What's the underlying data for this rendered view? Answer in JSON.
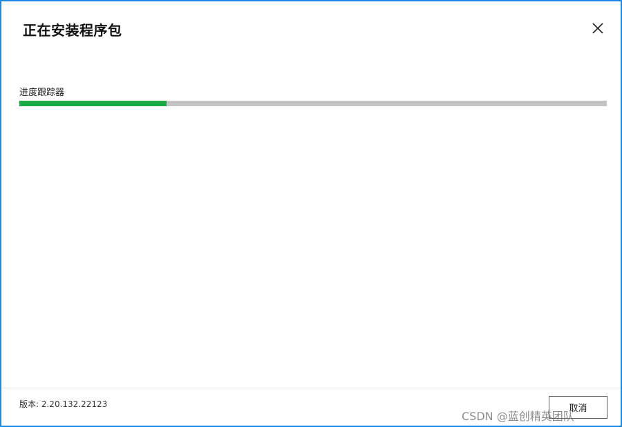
{
  "dialog": {
    "title": "正在安装程序包",
    "close_icon": "close-icon"
  },
  "progress": {
    "label": "进度跟踪器",
    "value_fraction": 0.25,
    "fill_color": "#1aab45",
    "track_color": "#c3c3c3"
  },
  "footer": {
    "version": "版本: 2.20.132.22123",
    "cancel_label": "取消"
  },
  "watermark": {
    "text": "CSDN @蓝创精英团队"
  },
  "colors": {
    "window_border": "#1e88e5"
  }
}
